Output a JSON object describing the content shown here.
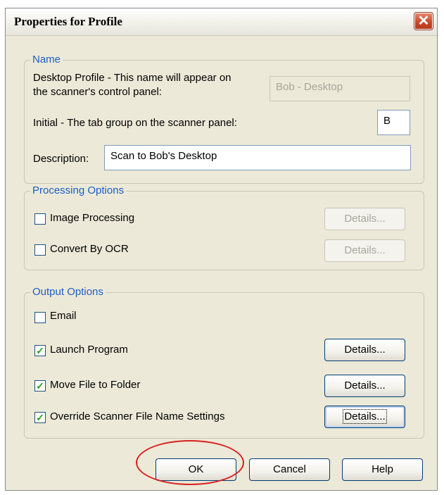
{
  "window": {
    "title": "Properties for Profile",
    "close_glyph": "✕"
  },
  "name_group": {
    "legend": "Name",
    "desktop_label_1": "Desktop Profile - This name will appear on",
    "desktop_label_2": "the scanner's control panel:",
    "desktop_value": "Bob - Desktop",
    "initial_label": "Initial - The tab group on the scanner panel:",
    "initial_value": "B",
    "description_label": "Description:",
    "description_value": "Scan to Bob's Desktop"
  },
  "processing_group": {
    "legend": "Processing Options",
    "items": [
      {
        "label": "Image Processing",
        "checked": false,
        "details": "Details...",
        "details_enabled": false
      },
      {
        "label": "Convert By OCR",
        "checked": false,
        "details": "Details...",
        "details_enabled": false
      }
    ]
  },
  "output_group": {
    "legend": "Output Options",
    "email_label": "Email",
    "email_checked": false,
    "items": [
      {
        "label": "Launch Program",
        "checked": true,
        "details": "Details..."
      },
      {
        "label": "Move File to Folder",
        "checked": true,
        "details": "Details..."
      },
      {
        "label": "Override Scanner File Name Settings",
        "checked": true,
        "details": "Details..."
      }
    ]
  },
  "footer": {
    "ok": "OK",
    "cancel": "Cancel",
    "help": "Help"
  },
  "colors": {
    "accent": "#1c5ec4",
    "dialog_bg": "#ece9d8",
    "annotation": "#d92020",
    "check": "#21a121"
  },
  "check_glyph": "✓"
}
